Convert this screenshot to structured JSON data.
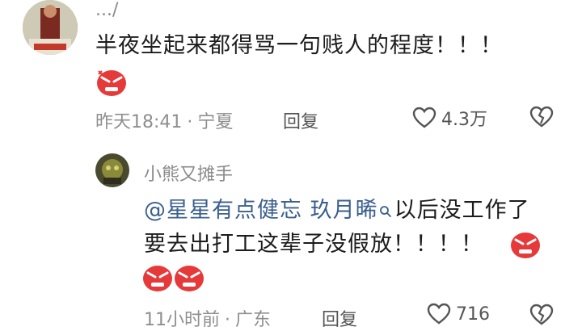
{
  "comment1": {
    "username": ".../",
    "text": "半夜坐起来都得骂一句贱人的程度！！！",
    "emoji_icon": "angry-face-icon",
    "time": "昨天18:41",
    "location": "宁夏",
    "reply_label": "回复",
    "likes": "4.3万"
  },
  "comment2": {
    "username": "小熊又摊手",
    "mention1": "@星星有点健忘",
    "mention2": "玖月晞",
    "search_icon": "search-icon",
    "text_line1": "以后没工作了",
    "text_line2": "要去出打工这辈子没假放！！！！",
    "emoji_icon": "angry-face-icon",
    "time": "11小时前",
    "location": "广东",
    "reply_label": "回复",
    "likes": "716"
  },
  "colors": {
    "accent_link": "#3a5f8f",
    "emoji_red": "#e63a3a"
  }
}
